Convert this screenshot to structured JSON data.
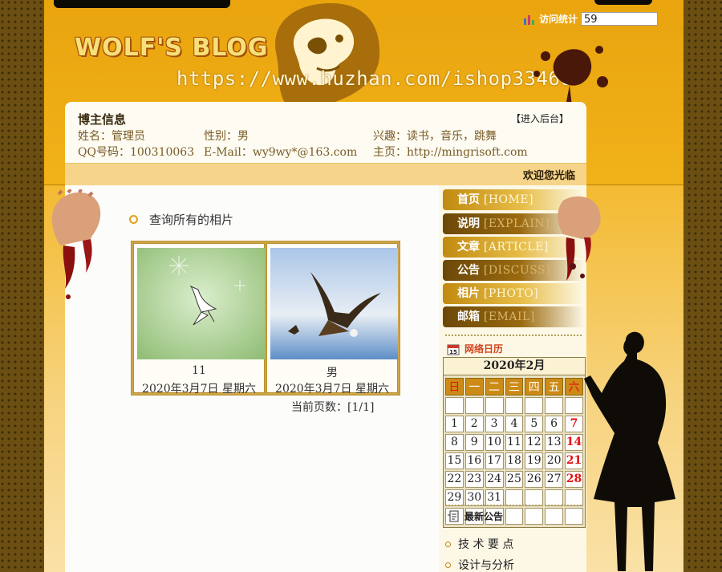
{
  "header": {
    "logo_text": "WOLF'S BLOG",
    "watermark": "https://www.huzhan.com/ishop33466",
    "counter_label": "访问统计",
    "counter_value": "59"
  },
  "blogger": {
    "title": "博主信息",
    "admin_link": "【进入后台】",
    "name": "姓名：管理员",
    "gender": "性别：男",
    "hobby": "兴趣：读书，音乐，跳舞",
    "qq": "QQ号码：100310063",
    "email": "E-Mail：wy9wy*@163.com",
    "homepage": "主页：http://mingrisoft.com"
  },
  "welcome": "欢迎您光临",
  "main": {
    "section_title": "查询所有的相片",
    "photos": [
      {
        "name": "11",
        "date": "2020年3月7日  星期六"
      },
      {
        "name": "男",
        "date": "2020年3月7日  星期六"
      }
    ],
    "pager": "当前页数：[1/1]"
  },
  "nav": [
    {
      "zh": "首页",
      "en": "[HOME]"
    },
    {
      "zh": "说明",
      "en": "[EXPLAIN]"
    },
    {
      "zh": "文章",
      "en": "[ARTICLE]"
    },
    {
      "zh": "公告",
      "en": "[DISCUSS]"
    },
    {
      "zh": "相片",
      "en": "[PHOTO]"
    },
    {
      "zh": "邮箱",
      "en": "[EMAIL]"
    }
  ],
  "calendar": {
    "widget_title": "网络日历",
    "month_title": "2020年2月",
    "weekdays": [
      "日",
      "一",
      "二",
      "三",
      "四",
      "五",
      "六"
    ],
    "weeks": [
      [
        "",
        "",
        "",
        "",
        "",
        "",
        ""
      ],
      [
        "1",
        "2",
        "3",
        "4",
        "5",
        "6",
        "7"
      ],
      [
        "8",
        "9",
        "10",
        "11",
        "12",
        "13",
        "14"
      ],
      [
        "15",
        "16",
        "17",
        "18",
        "19",
        "20",
        "21"
      ],
      [
        "22",
        "23",
        "24",
        "25",
        "26",
        "27",
        "28"
      ],
      [
        "29",
        "30",
        "31",
        "",
        "",
        "",
        ""
      ],
      [
        "",
        "",
        "",
        "",
        "",
        "",
        ""
      ]
    ]
  },
  "notices": {
    "title": "最新公告",
    "items": [
      "技 术 要 点",
      "设计与分析"
    ]
  },
  "colors": {
    "accent": "#e3a019",
    "nav_dark": "#6b4708",
    "nav_light": "#c08a10",
    "weekend": "#e61010"
  }
}
